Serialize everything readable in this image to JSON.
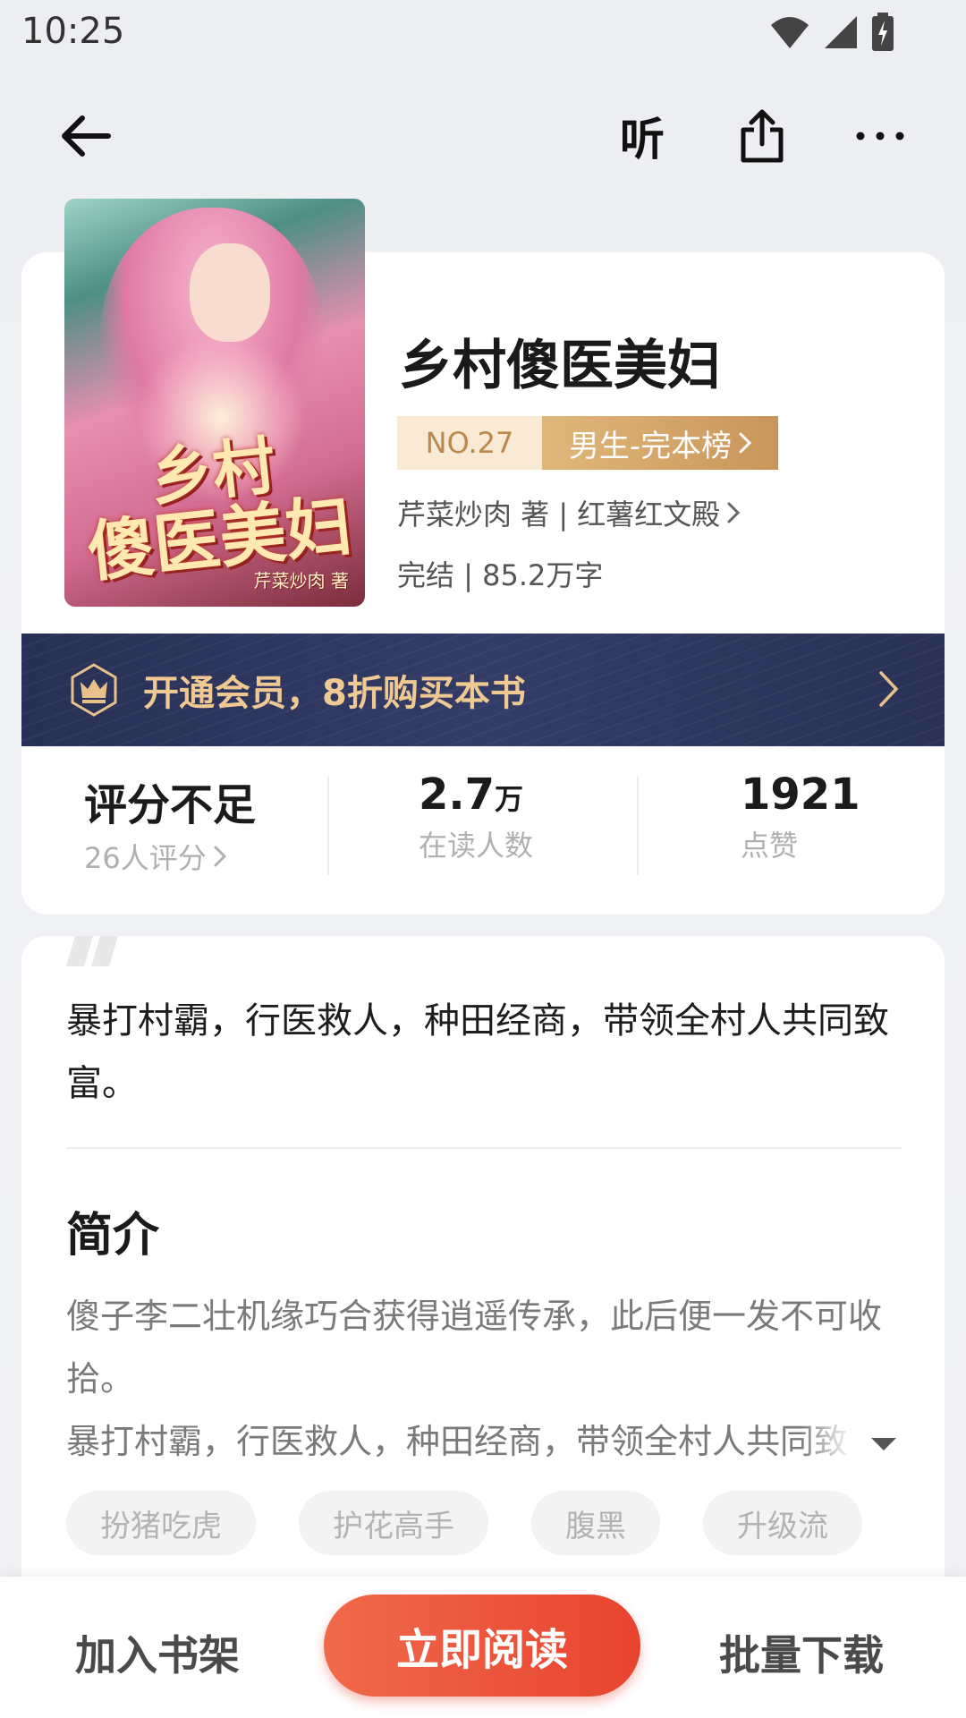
{
  "status_bar": {
    "time": "10:25",
    "icons": [
      "wifi-icon",
      "signal-icon",
      "battery-charging-icon"
    ]
  },
  "top_nav": {
    "listen_label": "听",
    "icons": [
      "back-arrow-icon",
      "share-icon",
      "more-icon"
    ]
  },
  "book": {
    "cover_title_line1": "乡村",
    "cover_title_line2": "傻医美妇",
    "cover_author": "芹菜炒肉 著",
    "title": "乡村傻医美妇",
    "rank_no": "NO.27",
    "rank_list": "男生-完本榜",
    "author_line": "芹菜炒肉 著 | 红薯红文殿",
    "status_line": "完结 | 85.2万字"
  },
  "vip_banner": {
    "text": "开通会员，8折购买本书"
  },
  "stats": {
    "rating": {
      "main": "评分不足",
      "sub": "26人评分"
    },
    "readers": {
      "value": "2.7",
      "unit": "万",
      "sub": "在读人数"
    },
    "likes": {
      "value": "1921",
      "sub": "点赞"
    }
  },
  "detail": {
    "tagline": "暴打村霸，行医救人，种田经商，带领全村人共同致富。",
    "intro_title": "简介",
    "intro_text": "傻子李二壮机缘巧合获得逍遥传承，此后便一发不可收拾。",
    "intro_text_line3": "暴打村霸，行医救人，种田经商，带领全村人共同致富。",
    "tags": [
      "扮猪吃虎",
      "护花高手",
      "腹黑",
      "升级流"
    ]
  },
  "bottom_bar": {
    "add_shelf": "加入书架",
    "read_now": "立即阅读",
    "batch_download": "批量下载"
  },
  "colors": {
    "accent": "#e8432f",
    "gold": "#c9955a",
    "vip_bg": "#2c3459",
    "vip_text": "#f0c892"
  }
}
